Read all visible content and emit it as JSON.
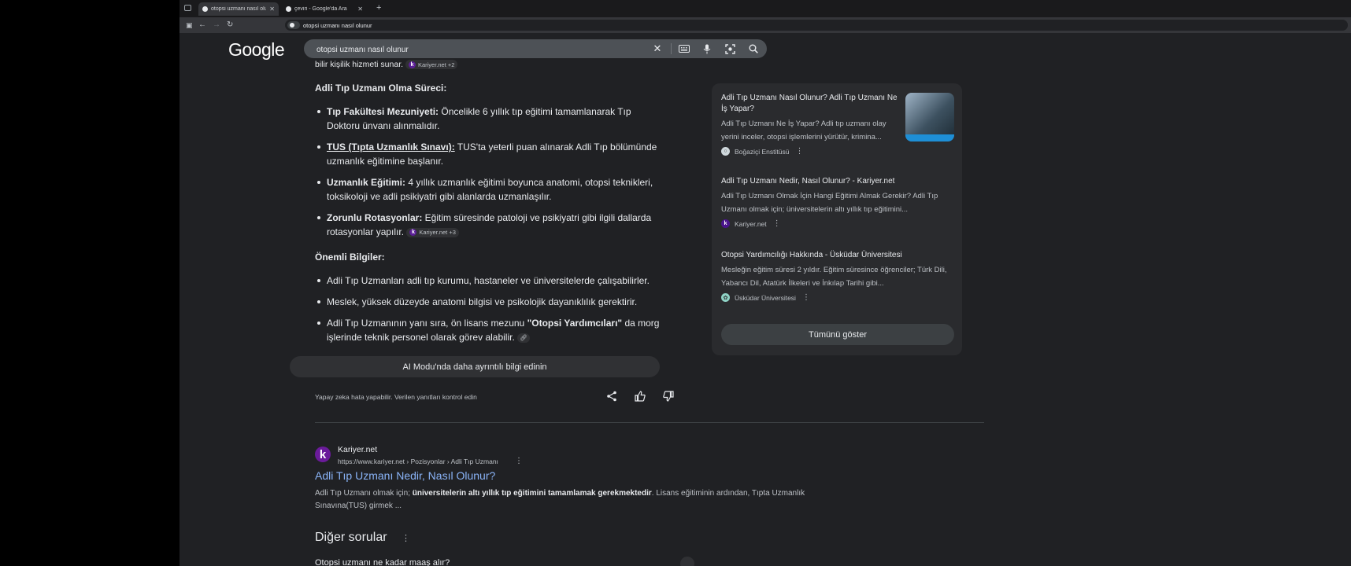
{
  "browser": {
    "tabs": [
      {
        "label": "otopsi uzmanı nasıl olunur - Go",
        "active": true
      },
      {
        "label": "çeviri - Google'da Ara",
        "active": false
      }
    ],
    "address": "otopsi uzmanı nasıl olunur"
  },
  "google": {
    "logo": "Google",
    "query": "otopsi uzmanı nasıl olunur"
  },
  "ai_overview": {
    "top_cut_text": "bilir kişilik hizmeti sunar.",
    "top_cite": "Kariyer.net +2",
    "process_heading": "Adli Tıp Uzmanı Olma Süreci:",
    "process_items": [
      {
        "key": "Tıp Fakültesi Mezuniyeti:",
        "text": " Öncelikle 6 yıllık tıp eğitimi tamamlanarak Tıp Doktoru ünvanı alınmalıdır."
      },
      {
        "key": "TUS (Tıpta Uzmanlık Sınavı):",
        "text": " TUS'ta yeterli puan alınarak Adli Tıp bölümünde uzmanlık eğitimine başlanır."
      },
      {
        "key": "Uzmanlık Eğitimi:",
        "text": " 4 yıllık uzmanlık eğitimi boyunca anatomi, otopsi teknikleri, toksikoloji ve adli psikiyatri gibi alanlarda uzmanlaşılır."
      },
      {
        "key": "Zorunlu Rotasyonlar:",
        "text": " Eğitim süresinde patoloji ve psikiyatri gibi ilgili dallarda rotasyonlar yapılır."
      }
    ],
    "rotation_cite": "Kariyer.net +3",
    "important_heading": "Önemli Bilgiler:",
    "important_items": [
      "Adli Tıp Uzmanları adli tıp kurumu, hastaneler ve üniversitelerde çalışabilirler.",
      "Meslek, yüksek düzeyde anatomi bilgisi ve psikolojik dayanıklılık gerektirir."
    ],
    "last_item_a": "Adli Tıp Uzmanının yanı sıra, ön lisans mezunu ",
    "last_item_bold": "\"Otopsi Yardımcıları\"",
    "last_item_b": " da morg işlerinde teknik personel olarak görev alabilir.",
    "ai_mode_button": "AI Modu'nda daha ayrıntılı bilgi edinin",
    "disclaimer": "Yapay zeka hata yapabilir. Verilen yanıtları kontrol edin"
  },
  "sources_panel": {
    "items": [
      {
        "title": "Adli Tıp Uzmanı Nasıl Olunur? Adli Tıp Uzmanı Ne İş Yapar?",
        "snippet": "Adli Tıp Uzmanı Ne İş Yapar? Adli tıp uzmanı olay yerini inceler, otopsi işlemlerini yürütür, krimina...",
        "source": "Boğaziçi Enstitüsü"
      },
      {
        "title": "Adli Tıp Uzmanı Nedir, Nasıl Olunur? - Kariyer.net",
        "snippet": "Adli Tıp Uzmanı Olmak İçin Hangi Eğitimi Almak Gerekir? Adli Tıp Uzmanı olmak için; üniversitelerin altı yıllık tıp eğitimini...",
        "source": "Kariyer.net"
      },
      {
        "title": "Otopsi Yardımcılığı Hakkında - Üsküdar Üniversitesi",
        "snippet": "Mesleğin eğitim süresi 2 yıldır. Eğitim süresince öğrenciler; Türk Dili, Yabancı Dil, Atatürk İlkeleri ve İnkılap Tarihi gibi...",
        "source": "Üsküdar Üniversitesi"
      }
    ],
    "show_all": "Tümünü göster"
  },
  "result": {
    "site": "Kariyer.net",
    "url": "https://www.kariyer.net › Pozisyonlar › Adli Tıp Uzmanı",
    "title": "Adli Tıp Uzmanı Nedir, Nasıl Olunur?",
    "snippet_a": "Adli Tıp Uzmanı olmak için; ",
    "snippet_bold": "üniversitelerin altı yıllık tıp eğitimini tamamlamak gerekmektedir",
    "snippet_b": ". Lisans eğitiminin ardından, Tıpta Uzmanlık Sınavına(TUS) girmek ..."
  },
  "other_questions": {
    "heading": "Diğer sorular",
    "first": "Otopsi uzmanı ne kadar maaş alır?"
  },
  "colors": {
    "link": "#8ab4f8",
    "background": "#202124",
    "panel": "#2a2b2e"
  }
}
